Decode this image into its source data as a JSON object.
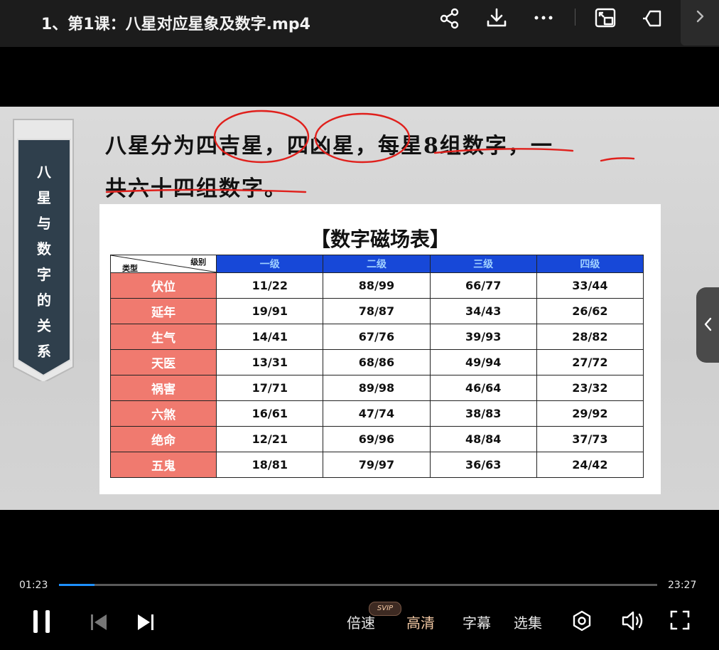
{
  "header": {
    "title": "1、第1课：八星对应星象及数字.mp4",
    "icons": [
      "share-icon",
      "download-icon",
      "more-icon",
      "picture-in-picture-icon",
      "pin-icon",
      "chevron-right-icon"
    ]
  },
  "video": {
    "banner_text": [
      "八",
      "星",
      "与",
      "数",
      "字",
      "的",
      "关",
      "系"
    ],
    "line1": "八星分为四吉星，四凶星，每星8组数字，一",
    "line2": "共六十四组数字。",
    "table": {
      "title": "【数字磁场表】",
      "corner_type": "类型",
      "corner_level": "级别",
      "levels": [
        "一级",
        "二级",
        "三级",
        "四级"
      ],
      "rows": [
        {
          "type": "伏位",
          "values": [
            "11/22",
            "88/99",
            "66/77",
            "33/44"
          ]
        },
        {
          "type": "延年",
          "values": [
            "19/91",
            "78/87",
            "34/43",
            "26/62"
          ]
        },
        {
          "type": "生气",
          "values": [
            "14/41",
            "67/76",
            "39/93",
            "28/82"
          ]
        },
        {
          "type": "天医",
          "values": [
            "13/31",
            "68/86",
            "49/94",
            "27/72"
          ]
        },
        {
          "type": "祸害",
          "values": [
            "17/71",
            "89/98",
            "46/64",
            "23/32"
          ]
        },
        {
          "type": "六煞",
          "values": [
            "16/61",
            "47/74",
            "38/83",
            "29/92"
          ]
        },
        {
          "type": "绝命",
          "values": [
            "12/21",
            "69/96",
            "48/84",
            "37/73"
          ]
        },
        {
          "type": "五鬼",
          "values": [
            "18/81",
            "79/97",
            "36/63",
            "24/42"
          ]
        }
      ]
    },
    "colors": {
      "level_header": "#1748d8",
      "type_cell": "#f07a6f",
      "ink": "#e0201c",
      "banner": "#2f3f4c"
    }
  },
  "player": {
    "current_time": "01:23",
    "total_time": "23:27",
    "progress": 0.059,
    "speed_label": "倍速",
    "quality_label": "高清",
    "svip_badge": "SVIP",
    "subtitle_label": "字幕",
    "episodes_label": "选集",
    "accent": "#1e90ff"
  }
}
